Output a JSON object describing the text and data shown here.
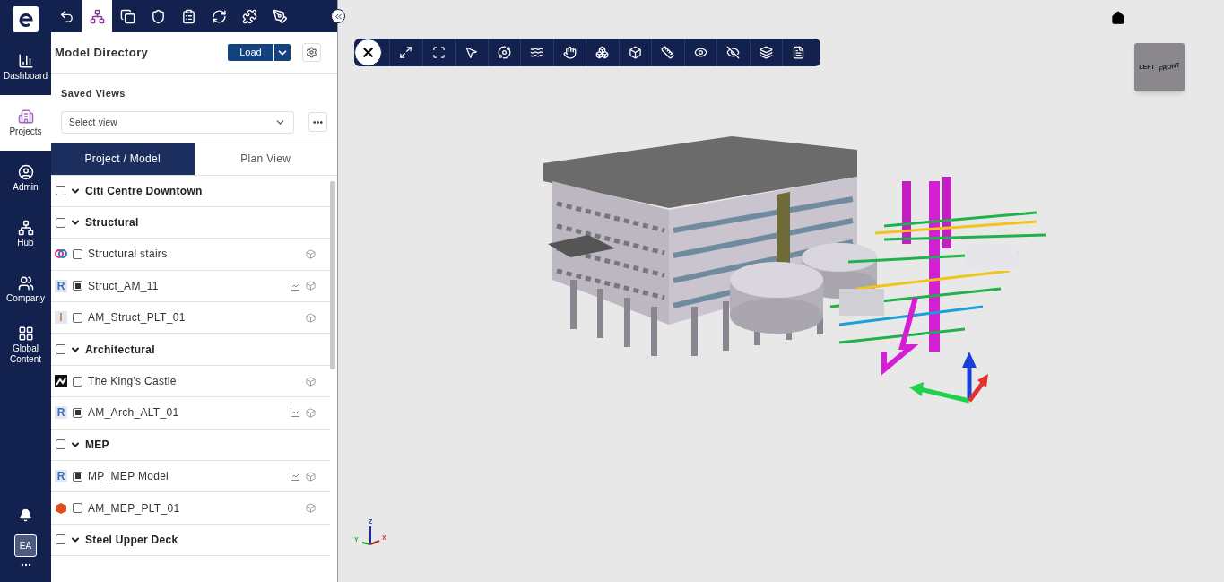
{
  "nav": {
    "items": [
      {
        "label": "Dashboard",
        "selected": false
      },
      {
        "label": "Projects",
        "selected": true
      },
      {
        "label": "Admin",
        "selected": false
      },
      {
        "label": "Hub",
        "selected": false
      },
      {
        "label": "Company",
        "selected": false
      },
      {
        "label": "Global Content",
        "selected": false
      }
    ],
    "user_initials": "EA"
  },
  "panel_tabs": [
    {
      "selected": false
    },
    {
      "selected": true
    },
    {
      "selected": false
    },
    {
      "selected": false
    },
    {
      "selected": false
    },
    {
      "selected": false
    },
    {
      "selected": false
    },
    {
      "selected": false
    }
  ],
  "panel": {
    "title": "Model Directory",
    "load_button": "Load",
    "saved_views_label": "Saved Views",
    "view_select": {
      "placeholder": "Select view"
    }
  },
  "view_tabs": [
    {
      "label": "Project / Model",
      "selected": true
    },
    {
      "label": "Plan View",
      "selected": false
    }
  ],
  "tree": [
    {
      "label": "Citi Centre Downtown",
      "checked": false,
      "expanded": true,
      "children": [
        {
          "label": "Structural",
          "checked": false,
          "expanded": true,
          "children": [
            {
              "label": "Structural stairs",
              "loaded": false,
              "chart": false,
              "source": {
                "kind": "rings"
              }
            },
            {
              "label": "Struct_AM_11",
              "loaded": true,
              "chart": true,
              "source": {
                "kind": "letter",
                "text": "R",
                "color": "#3b6fb6"
              }
            },
            {
              "label": "AM_Struct_PLT_01",
              "loaded": false,
              "chart": false,
              "source": {
                "kind": "letter",
                "text": "I",
                "color": "#d9822b"
              }
            }
          ]
        },
        {
          "label": "Architectural",
          "checked": false,
          "expanded": true,
          "children": [
            {
              "label": "The King's Castle",
              "loaded": false,
              "chart": false,
              "source": {
                "kind": "photo"
              }
            },
            {
              "label": "AM_Arch_ALT_01",
              "loaded": true,
              "chart": true,
              "source": {
                "kind": "letter",
                "text": "R",
                "color": "#3b6fb6"
              }
            }
          ]
        },
        {
          "label": "MEP",
          "checked": false,
          "expanded": true,
          "children": [
            {
              "label": "MP_MEP Model",
              "loaded": true,
              "chart": true,
              "source": {
                "kind": "letter",
                "text": "R",
                "color": "#3b6fb6"
              }
            },
            {
              "label": "AM_MEP_PLT_01",
              "loaded": false,
              "chart": false,
              "source": {
                "kind": "badge"
              }
            }
          ]
        },
        {
          "label": "Steel Upper Deck",
          "checked": false,
          "expanded": true
        }
      ]
    }
  ],
  "viewcube": {
    "left": "LEFT",
    "front": "FRONT"
  },
  "axes": {
    "x": "X",
    "y": "Y",
    "z": "Z"
  }
}
